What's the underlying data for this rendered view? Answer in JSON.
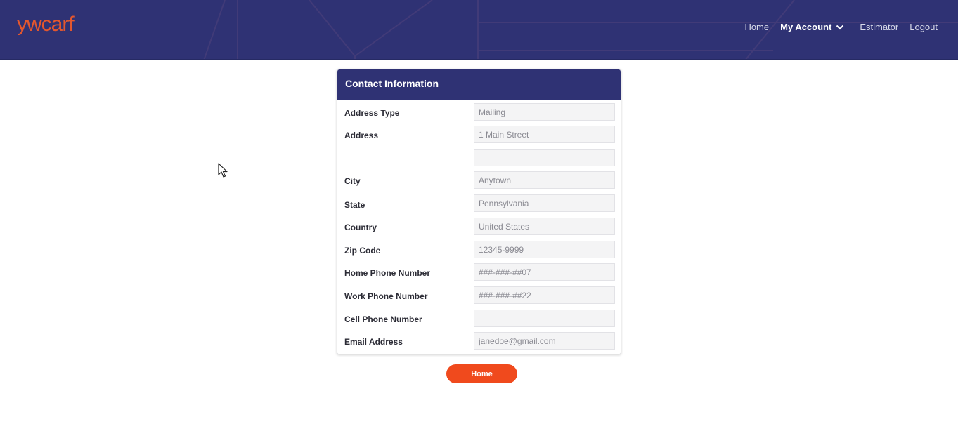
{
  "brand": {
    "logo_text": "ywcarf",
    "logo_color": "#e4572e",
    "header_color": "#2f3274"
  },
  "nav": {
    "home": "Home",
    "my_account": "My Account",
    "estimator": "Estimator",
    "logout": "Logout"
  },
  "card": {
    "title": "Contact Information",
    "fields": [
      {
        "label": "Address Type",
        "value": "Mailing"
      },
      {
        "label": "Address",
        "value": "1 Main Street"
      },
      {
        "label": "",
        "value": ""
      },
      {
        "label": "City",
        "value": "Anytown"
      },
      {
        "label": "State",
        "value": "Pennsylvania"
      },
      {
        "label": "Country",
        "value": "United States"
      },
      {
        "label": "Zip Code",
        "value": "12345-9999"
      },
      {
        "label": "Home Phone Number",
        "value": "###-###-##07"
      },
      {
        "label": "Work Phone Number",
        "value": "###-###-##22"
      },
      {
        "label": "Cell Phone Number",
        "value": ""
      },
      {
        "label": "Email Address",
        "value": "janedoe@gmail.com"
      }
    ]
  },
  "actions": {
    "home_button": "Home",
    "button_color": "#f04a1d"
  }
}
